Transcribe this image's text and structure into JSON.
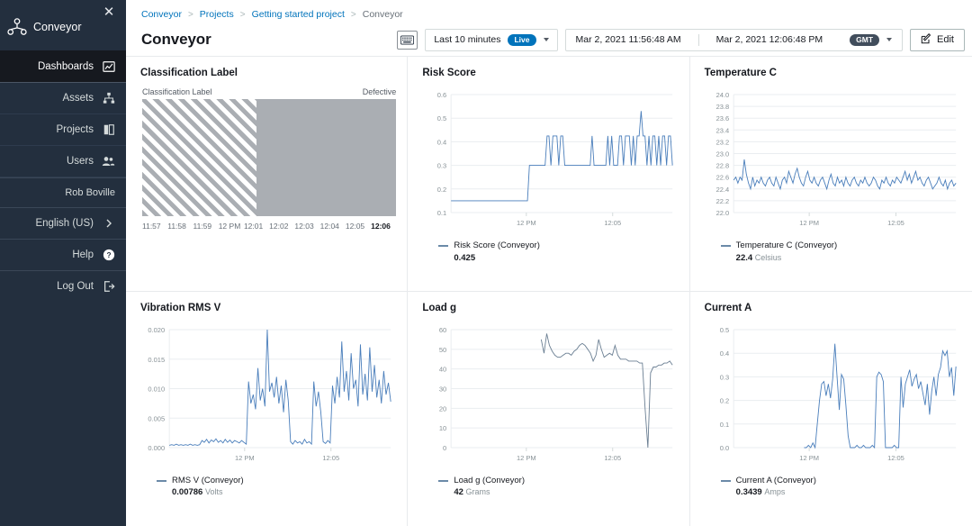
{
  "sidebar": {
    "close_icon": "close-icon",
    "brand": "Conveyor",
    "items": [
      {
        "label": "Dashboards",
        "icon": "dashboard-icon",
        "active": true
      },
      {
        "label": "Assets",
        "icon": "assets-hierarchy-icon",
        "active": false
      },
      {
        "label": "Projects",
        "icon": "projects-book-icon",
        "active": false
      },
      {
        "label": "Users",
        "icon": "users-icon",
        "active": false
      }
    ],
    "user": "Rob Boville",
    "language": "English (US)",
    "language_icon": "chevron-right-icon",
    "help": "Help",
    "help_icon": "question-circle-icon",
    "logout": "Log Out",
    "logout_icon": "logout-arrow-icon"
  },
  "breadcrumb": {
    "items": [
      "Conveyor",
      "Projects",
      "Getting started project",
      "Conveyor"
    ],
    "separator": ">"
  },
  "header": {
    "title": "Conveyor",
    "keyboard_icon": "keyboard-icon",
    "range_label": "Last 10 minutes",
    "live_badge": "Live",
    "start_time": "Mar 2, 2021 11:56:48 AM",
    "end_time": "Mar 2, 2021 12:06:48 PM",
    "timezone_badge": "GMT",
    "edit_label": "Edit",
    "edit_icon": "edit-pencil-icon",
    "accent_color": "#0073bb",
    "badge_dark_color": "#414d5c"
  },
  "chart_data": [
    {
      "type": "table",
      "title": "Classification Label",
      "series_label": "Classification Label",
      "current_state": "Defective",
      "xlabel": "",
      "ylabel": "",
      "tick_labels": [
        "11:57",
        "11:58",
        "11:59",
        "12 PM",
        "12:01",
        "12:02",
        "12:03",
        "12:04",
        "12:05",
        "12:06"
      ],
      "bands": [
        {
          "from": "11:57",
          "to": "12:01",
          "state": "Normal",
          "fill": "hatched",
          "color": "#aaaeb3"
        },
        {
          "from": "12:01",
          "to": "12:06",
          "state": "Defective",
          "fill": "solid",
          "color": "#aaaeb3"
        }
      ]
    },
    {
      "type": "line",
      "title": "Risk Score",
      "series": [
        {
          "name": "Risk Score (Conveyor)",
          "value": "0.425",
          "unit": "",
          "color": "#4a7ebb",
          "values": [
            0.15,
            0.15,
            0.15,
            0.15,
            0.15,
            0.15,
            0.15,
            0.15,
            0.15,
            0.15,
            0.15,
            0.15,
            0.15,
            0.15,
            0.15,
            0.15,
            0.15,
            0.15,
            0.15,
            0.15,
            0.15,
            0.15,
            0.15,
            0.15,
            0.15,
            0.15,
            0.15,
            0.15,
            0.15,
            0.15,
            0.15,
            0.15,
            0.15,
            0.15,
            0.15,
            0.15,
            0.15,
            0.15,
            0.15,
            0.15,
            0.3,
            0.3,
            0.3,
            0.3,
            0.3,
            0.3,
            0.3,
            0.3,
            0.3,
            0.425,
            0.425,
            0.3,
            0.425,
            0.425,
            0.425,
            0.3,
            0.425,
            0.425,
            0.3,
            0.3,
            0.3,
            0.3,
            0.3,
            0.3,
            0.3,
            0.3,
            0.3,
            0.3,
            0.3,
            0.3,
            0.3,
            0.3,
            0.425,
            0.3,
            0.3,
            0.3,
            0.3,
            0.3,
            0.3,
            0.3,
            0.425,
            0.3,
            0.425,
            0.3,
            0.3,
            0.3,
            0.425,
            0.425,
            0.3,
            0.425,
            0.425,
            0.425,
            0.3,
            0.425,
            0.3,
            0.425,
            0.425,
            0.53,
            0.425,
            0.425,
            0.3,
            0.425,
            0.3,
            0.425,
            0.425,
            0.3,
            0.425,
            0.3,
            0.425,
            0.425,
            0.3,
            0.425,
            0.425,
            0.3
          ]
        }
      ],
      "ylim": [
        0.1,
        0.6
      ],
      "yticks": [
        "0.6",
        "0.5",
        "0.4",
        "0.3",
        "0.2",
        "0.1"
      ],
      "xticks": [
        "12 PM",
        "12:05"
      ],
      "grid": true
    },
    {
      "type": "line",
      "title": "Temperature C",
      "series": [
        {
          "name": "Temperature C (Conveyor)",
          "value": "22.4",
          "unit": "Celsius",
          "color": "#4a7ebb",
          "values": [
            22.55,
            22.6,
            22.5,
            22.6,
            22.55,
            22.9,
            22.65,
            22.5,
            22.4,
            22.6,
            22.45,
            22.55,
            22.5,
            22.6,
            22.5,
            22.45,
            22.55,
            22.6,
            22.5,
            22.45,
            22.6,
            22.5,
            22.4,
            22.55,
            22.6,
            22.5,
            22.7,
            22.6,
            22.5,
            22.65,
            22.75,
            22.6,
            22.5,
            22.45,
            22.6,
            22.7,
            22.55,
            22.5,
            22.6,
            22.5,
            22.45,
            22.55,
            22.6,
            22.5,
            22.4,
            22.55,
            22.65,
            22.5,
            22.45,
            22.6,
            22.5,
            22.55,
            22.45,
            22.6,
            22.5,
            22.45,
            22.55,
            22.6,
            22.5,
            22.45,
            22.55,
            22.5,
            22.6,
            22.5,
            22.45,
            22.5,
            22.6,
            22.55,
            22.45,
            22.4,
            22.55,
            22.5,
            22.6,
            22.5,
            22.45,
            22.55,
            22.5,
            22.6,
            22.55,
            22.5,
            22.6,
            22.7,
            22.55,
            22.65,
            22.5,
            22.6,
            22.7,
            22.55,
            22.6,
            22.5,
            22.45,
            22.55,
            22.6,
            22.5,
            22.4,
            22.45,
            22.5,
            22.6,
            22.5,
            22.45,
            22.55,
            22.4,
            22.5,
            22.55,
            22.45,
            22.5
          ]
        }
      ],
      "ylim": [
        22.0,
        24.0
      ],
      "yticks": [
        "24.0",
        "23.8",
        "23.6",
        "23.4",
        "23.2",
        "23.0",
        "22.8",
        "22.6",
        "22.4",
        "22.2",
        "22.0"
      ],
      "xticks": [
        "12 PM",
        "12:05"
      ],
      "grid": true
    },
    {
      "type": "line",
      "title": "Vibration RMS V",
      "series": [
        {
          "name": "RMS V (Conveyor)",
          "value": "0.00786",
          "unit": "Volts",
          "color": "#4a7ebb",
          "values": [
            0.0004,
            0.0005,
            0.0004,
            0.0006,
            0.0004,
            0.0005,
            0.0004,
            0.0005,
            0.0004,
            0.0006,
            0.0004,
            0.0005,
            0.0004,
            0.0005,
            0.0012,
            0.0009,
            0.0014,
            0.0008,
            0.0013,
            0.001,
            0.0015,
            0.0009,
            0.0012,
            0.0008,
            0.0014,
            0.0009,
            0.0013,
            0.0008,
            0.0012,
            0.001,
            0.0008,
            0.0012,
            0.0009,
            0.0006,
            0.0112,
            0.0075,
            0.009,
            0.0065,
            0.0135,
            0.008,
            0.01,
            0.007,
            0.0205,
            0.0095,
            0.011,
            0.0085,
            0.012,
            0.0075,
            0.0105,
            0.006,
            0.0115,
            0.008,
            0.001,
            0.0006,
            0.0012,
            0.0008,
            0.001,
            0.0006,
            0.0014,
            0.0008,
            0.001,
            0.0006,
            0.0112,
            0.007,
            0.0095,
            0.006,
            0.001,
            0.0007,
            0.0012,
            0.0008,
            0.0105,
            0.0075,
            0.012,
            0.0085,
            0.018,
            0.0095,
            0.013,
            0.008,
            0.016,
            0.01,
            0.0115,
            0.007,
            0.0175,
            0.009,
            0.0125,
            0.008,
            0.017,
            0.0095,
            0.014,
            0.0085,
            0.0115,
            0.0075,
            0.013,
            0.009,
            0.011,
            0.0078
          ]
        }
      ],
      "ylim": [
        0.0,
        0.02
      ],
      "yticks": [
        "0.020",
        "0.015",
        "0.010",
        "0.005",
        "0.000"
      ],
      "xticks": [
        "12 PM",
        "12:05"
      ],
      "grid": true
    },
    {
      "type": "line",
      "title": "Load g",
      "series": [
        {
          "name": "Load g (Conveyor)",
          "value": "42",
          "unit": "Grams",
          "color": "#6b7f93",
          "values": [
            null,
            null,
            null,
            null,
            null,
            null,
            null,
            null,
            null,
            null,
            null,
            null,
            null,
            null,
            null,
            null,
            null,
            null,
            null,
            null,
            null,
            null,
            null,
            null,
            null,
            null,
            null,
            null,
            null,
            null,
            null,
            null,
            null,
            55,
            48,
            58,
            52,
            49,
            47,
            46,
            46,
            47,
            48,
            48,
            47,
            49,
            50,
            52,
            53,
            52,
            50,
            48,
            44,
            47,
            55,
            50,
            46,
            47,
            48,
            47,
            52,
            47,
            45,
            45,
            45,
            44,
            44,
            44,
            44,
            43,
            43,
            20,
            0,
            38,
            41,
            41,
            42,
            42,
            43,
            43,
            44,
            42
          ]
        }
      ],
      "ylim": [
        0,
        60
      ],
      "yticks": [
        "60",
        "50",
        "40",
        "30",
        "20",
        "10",
        "0"
      ],
      "xticks": [
        "12 PM",
        "12:05"
      ],
      "grid": true
    },
    {
      "type": "line",
      "title": "Current A",
      "series": [
        {
          "name": "Current A (Conveyor)",
          "value": "0.3439",
          "unit": "Amps",
          "color": "#4a7ebb",
          "values": [
            null,
            null,
            null,
            null,
            null,
            null,
            null,
            null,
            null,
            null,
            null,
            null,
            null,
            null,
            null,
            null,
            null,
            null,
            null,
            null,
            null,
            null,
            null,
            null,
            null,
            null,
            null,
            null,
            null,
            null,
            null,
            null,
            0.0,
            -0.01,
            0.01,
            0.0,
            0.02,
            0.0,
            0.1,
            0.2,
            0.27,
            0.28,
            0.22,
            0.27,
            0.21,
            0.29,
            0.44,
            0.3,
            0.16,
            0.31,
            0.29,
            0.18,
            0.05,
            0.0,
            -0.01,
            0.0,
            0.01,
            -0.01,
            0.0,
            0.01,
            0.0,
            -0.01,
            0.0,
            0.01,
            0.0,
            0.3,
            0.32,
            0.31,
            0.28,
            0.0,
            -0.01,
            0.0,
            -0.02,
            0.01,
            0.0,
            0.0,
            0.3,
            0.17,
            0.27,
            0.3,
            0.33,
            0.26,
            0.29,
            0.31,
            0.25,
            0.28,
            0.23,
            0.18,
            0.27,
            0.14,
            0.24,
            0.3,
            0.22,
            0.31,
            0.34,
            0.41,
            0.39,
            0.41,
            0.3,
            0.34,
            0.22,
            0.3439
          ]
        }
      ],
      "ylim": [
        0.0,
        0.5
      ],
      "yticks": [
        "0.5",
        "0.4",
        "0.3",
        "0.2",
        "0.1",
        "0.0"
      ],
      "xticks": [
        "12 PM",
        "12:05"
      ],
      "grid": true
    }
  ]
}
